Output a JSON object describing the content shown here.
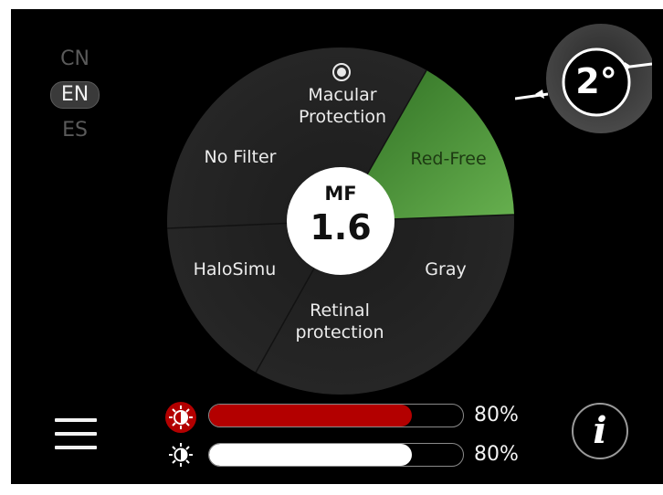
{
  "languages": {
    "options": [
      "CN",
      "EN",
      "ES"
    ],
    "selected": "EN"
  },
  "filter_wheel": {
    "segments": [
      {
        "label": "Macular\nProtection",
        "icon": "target-icon"
      },
      {
        "label": "Red-Free",
        "selected": true
      },
      {
        "label": "Gray"
      },
      {
        "label": "Retinal\nprotection"
      },
      {
        "label": "HaloSimu"
      },
      {
        "label": "No Filter"
      }
    ],
    "selected": "Red-Free",
    "center": {
      "title": "MF",
      "value": "1.6"
    }
  },
  "field_of_view": {
    "value": "2°"
  },
  "brightness": {
    "rows": [
      {
        "icon": "brightness-red-icon",
        "value_pct": 80,
        "label": "80%",
        "color": "#b30000"
      },
      {
        "icon": "brightness-icon",
        "value_pct": 80,
        "label": "80%",
        "color": "#ffffff"
      }
    ]
  },
  "info_button": {
    "label": "i"
  },
  "colors": {
    "background": "#000000",
    "selected_segment": "#3f8a2c",
    "accent_red": "#b30000"
  }
}
